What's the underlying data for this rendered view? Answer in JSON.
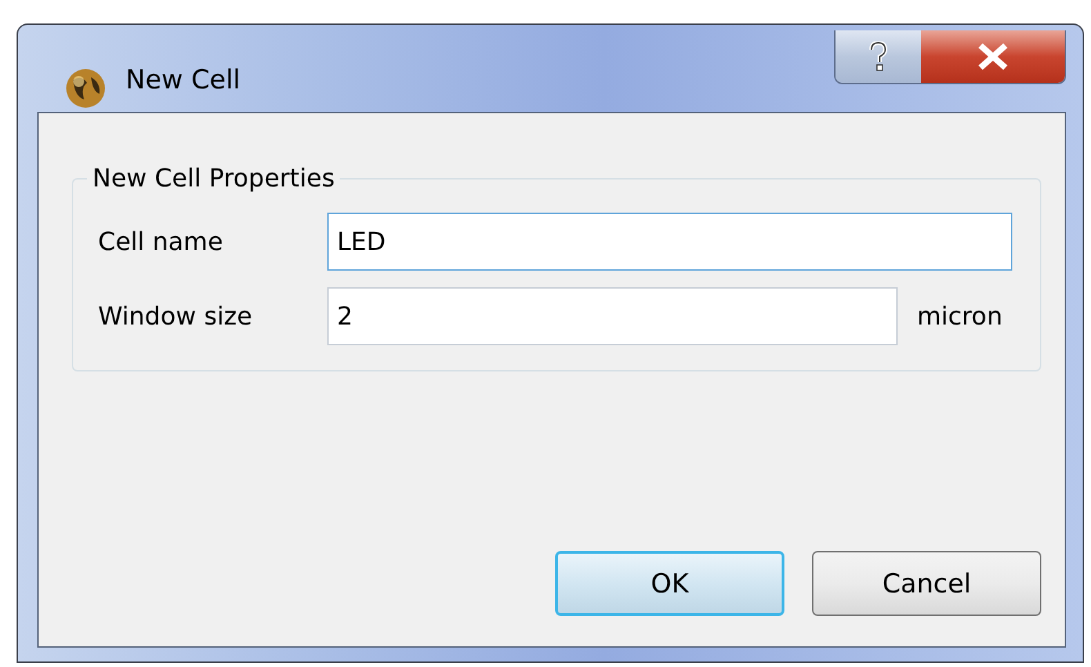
{
  "window": {
    "title": "New Cell"
  },
  "group": {
    "title": "New Cell Properties",
    "fields": [
      {
        "label": "Cell name",
        "value": "LED",
        "focused": true
      },
      {
        "label": "Window size",
        "value": "2",
        "unit": "micron",
        "focused": false
      }
    ]
  },
  "buttons": [
    {
      "label": "OK",
      "default": true
    },
    {
      "label": "Cancel",
      "default": false
    }
  ]
}
